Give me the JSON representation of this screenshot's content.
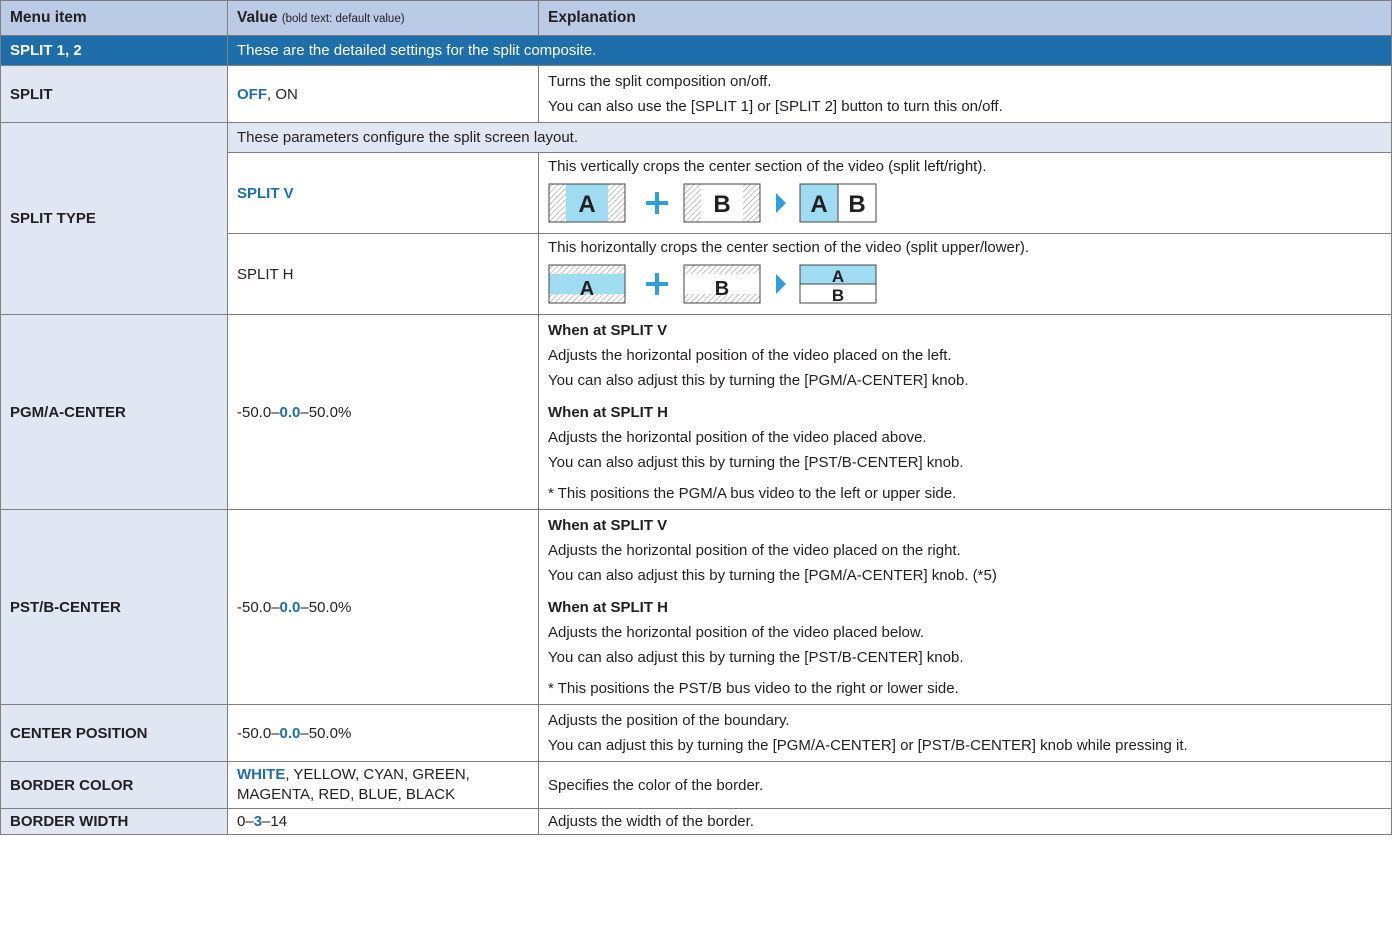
{
  "header": {
    "menu_item": "Menu item",
    "value": "Value",
    "value_note": "(bold text: default value)",
    "explanation": "Explanation"
  },
  "section": {
    "title": "SPLIT 1, 2",
    "desc": "These are the detailed settings for the split composite."
  },
  "rows": {
    "split": {
      "name": "SPLIT",
      "value_default": "OFF",
      "value_rest": ", ON",
      "lines": [
        "Turns the split composition on/off.",
        "You can also use the [SPLIT 1] or [SPLIT 2] button to turn this on/off."
      ]
    },
    "split_type": {
      "name": "SPLIT TYPE",
      "sub_desc": "These parameters configure the split screen layout.",
      "v_value": "SPLIT V",
      "v_desc": "This vertically crops the center section of the video (split left/right).",
      "h_value": "SPLIT H",
      "h_desc": "This horizontally crops the center section of the video (split upper/lower).",
      "letter_a": "A",
      "letter_b": "B"
    },
    "pgm": {
      "name": "PGM/A-CENTER",
      "val_pre": "-50.0–",
      "val_def": "0.0",
      "val_post": "–50.0%",
      "v_head": "When at SPLIT V",
      "v_lines": [
        "Adjusts the horizontal position of the video placed on the left.",
        "You can also adjust this by turning the [PGM/A-CENTER] knob."
      ],
      "h_head": "When at SPLIT H",
      "h_lines": [
        "Adjusts the horizontal position of the video placed above.",
        "You can also adjust this by turning the [PST/B-CENTER] knob."
      ],
      "note": "* This positions the PGM/A bus video to the left or upper side."
    },
    "pst": {
      "name": "PST/B-CENTER",
      "val_pre": "-50.0–",
      "val_def": "0.0",
      "val_post": "–50.0%",
      "v_head": "When at SPLIT V",
      "v_lines": [
        "Adjusts the horizontal position of the video placed on the right.",
        "You can also adjust this by turning the [PGM/A-CENTER] knob. (*5)"
      ],
      "h_head": "When at SPLIT H",
      "h_lines": [
        "Adjusts the horizontal position of the video placed below.",
        "You can also adjust this by turning the [PST/B-CENTER] knob."
      ],
      "note": "* This positions the PST/B bus video to the right or lower side."
    },
    "center_position": {
      "name": "CENTER POSITION",
      "val_pre": "-50.0–",
      "val_def": "0.0",
      "val_post": "–50.0%",
      "lines": [
        "Adjusts the position of the boundary.",
        "You can adjust this by turning the [PGM/A-CENTER] or [PST/B-CENTER] knob while pressing it."
      ]
    },
    "border_color": {
      "name": "BORDER COLOR",
      "val_def": "WHITE",
      "val_rest1": ", YELLOW, CYAN, GREEN,",
      "val_rest2": "MAGENTA, RED, BLUE, BLACK",
      "desc": "Specifies the color of the border."
    },
    "border_width": {
      "name": "BORDER WIDTH",
      "val_pre": "0–",
      "val_def": "3",
      "val_post": "–14",
      "desc": "Adjusts the width of the border."
    }
  },
  "colors": {
    "header_bg": "#bccbe5",
    "section_bg": "#1f6eac",
    "label_bg": "#e0e6f2",
    "accent_blue": "#1f6eac",
    "video_fill": "#9fdcf2",
    "arrow_blue": "#2e9fd9"
  }
}
